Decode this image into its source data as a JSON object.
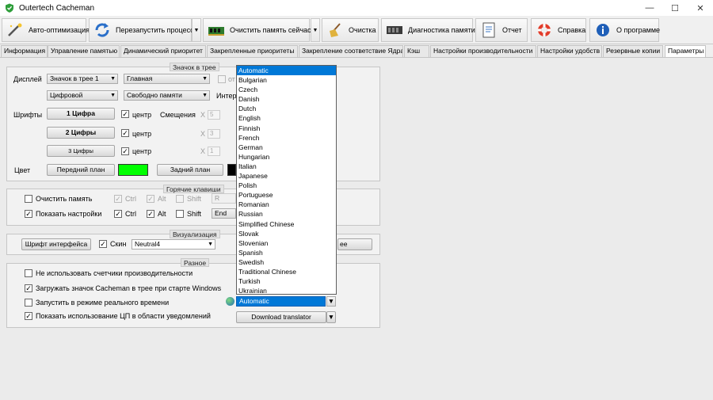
{
  "window": {
    "title": "Outertech Cacheman",
    "icon": "shield-check-icon"
  },
  "toolbar": {
    "auto_optimize": "Авто-оптимизация",
    "restart_process": "Перезапустить процесс",
    "clear_memory_now": "Очистить память сейчас!",
    "cleanup": "Очистка",
    "memory_diagnostics": "Диагностика памяти",
    "report": "Отчет",
    "help": "Справка",
    "about": "О программе"
  },
  "tabs": [
    "Информация",
    "Управление памятью",
    "Динамический приоритет",
    "Закрепленные приоритеты",
    "Закрепление соответствие Ядра",
    "Кэш",
    "Настройки производительности",
    "Настройки удобств",
    "Резервные копии",
    "Параметры"
  ],
  "tray_icon": {
    "group_title": "Значок в трее",
    "display_label": "Дисплей",
    "display_value": "Значок в трее 1",
    "main_value": "Главная",
    "digital_value": "Цифровой",
    "free_memory_value": "Свободно памяти",
    "faded_label_1": "от",
    "faded_label_2": "Интер",
    "fonts_label": "Шрифты",
    "digit1": "1 Цифра",
    "digit2": "2 Цифры",
    "digit3": "3 Цифры",
    "center": "центр",
    "offsets_label": "Смещения",
    "x_label": "X",
    "x1_value": "5",
    "x2_value": "3",
    "x3_value": "1",
    "color_label": "Цвет",
    "foreground": "Передний план",
    "background": "Задний план",
    "fg_color": "#00ff00",
    "bg_color": "#000000"
  },
  "hotkeys": {
    "group_title": "Горячие клавиши",
    "clear_memory": "Очистить память",
    "show_settings": "Показать настройки",
    "ctrl": "Ctrl",
    "alt": "Alt",
    "shift": "Shift",
    "key1": "R",
    "key2": "End"
  },
  "visualization": {
    "group_title": "Визуализация",
    "interface_font": "Шрифт интерфейса",
    "skin_label": "Скин",
    "skin_value": "Neutral4",
    "more_button": "ее"
  },
  "misc": {
    "group_title": "Разное",
    "opt1": "Не использовать счетчики производительности",
    "opt2": "Загружать значок Cacheman в трее при старте Windows",
    "opt3": "Запустить в режиме реального времени",
    "opt4": "Показать использование ЦП в области уведомлений",
    "language_value": "Automatic",
    "download_translator": "Download translator"
  },
  "language_dropdown": {
    "options": [
      "Automatic",
      "Bulgarian",
      "Czech",
      "Danish",
      "Dutch",
      "English",
      "Finnish",
      "French",
      "German",
      "Hungarian",
      "Italian",
      "Japanese",
      "Polish",
      "Portuguese",
      "Romanian",
      "Russian",
      "Simplified Chinese",
      "Slovak",
      "Slovenian",
      "Spanish",
      "Swedish",
      "Traditional Chinese",
      "Turkish",
      "Ukrainian"
    ],
    "selected": "Automatic"
  }
}
